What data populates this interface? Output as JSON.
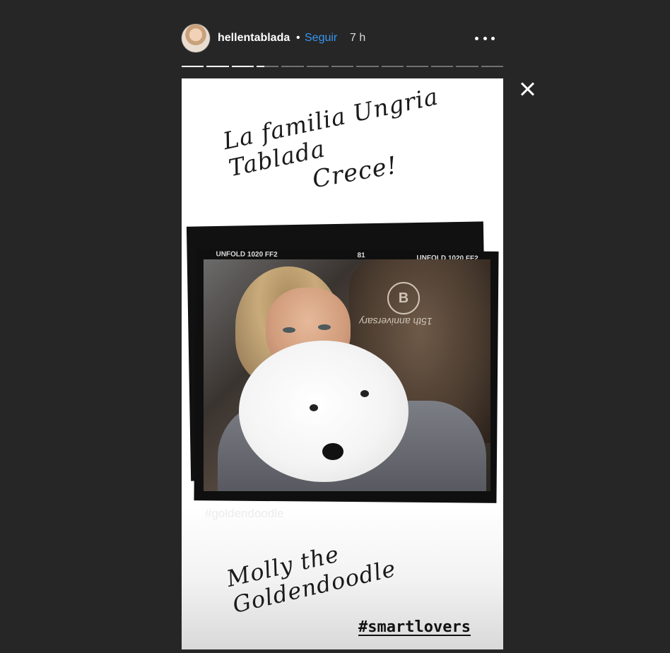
{
  "header": {
    "username": "hellentablada",
    "separator": "•",
    "follow_label": "Seguir",
    "time": "7 h",
    "avatar_icon": "profile-avatar",
    "more_icon": "ellipsis-icon"
  },
  "progress": {
    "segments": 13,
    "active_index": 3,
    "active_fraction": 0.35
  },
  "controls": {
    "close_icon": "close-icon"
  },
  "story": {
    "title_line1": "La familia Ungria Tablada",
    "title_line2": "Crece!",
    "film_label_left": "UNFOLD 1020 FF2",
    "film_label_center": "81",
    "film_label_right": "UNFOLD 1020 FF2",
    "seat_logo": "B",
    "seat_text": "15th anniversary",
    "hashtag_faint": "#goldendoodle",
    "subtitle": "Molly the Goldendoodle",
    "hashtag": "#smartlovers"
  },
  "colors": {
    "background": "#262626",
    "follow": "#3897f0",
    "text": "#ffffff"
  }
}
